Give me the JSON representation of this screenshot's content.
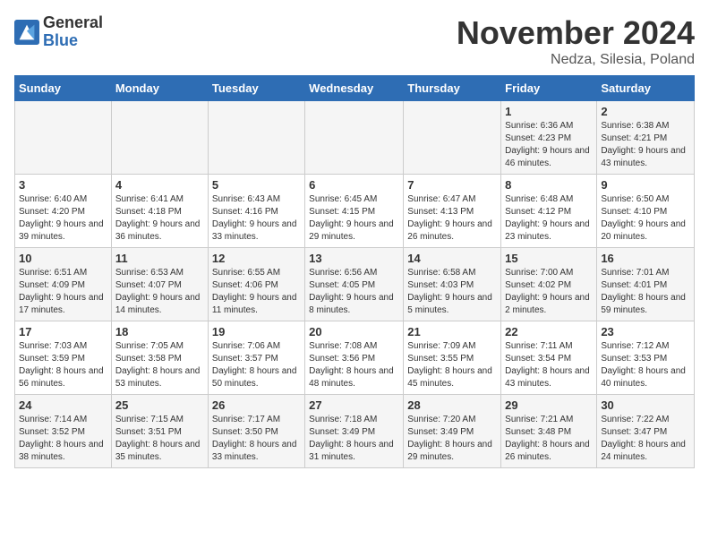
{
  "logo": {
    "general": "General",
    "blue": "Blue"
  },
  "title": "November 2024",
  "location": "Nedza, Silesia, Poland",
  "days_of_week": [
    "Sunday",
    "Monday",
    "Tuesday",
    "Wednesday",
    "Thursday",
    "Friday",
    "Saturday"
  ],
  "weeks": [
    [
      {
        "day": "",
        "info": ""
      },
      {
        "day": "",
        "info": ""
      },
      {
        "day": "",
        "info": ""
      },
      {
        "day": "",
        "info": ""
      },
      {
        "day": "",
        "info": ""
      },
      {
        "day": "1",
        "info": "Sunrise: 6:36 AM\nSunset: 4:23 PM\nDaylight: 9 hours and 46 minutes."
      },
      {
        "day": "2",
        "info": "Sunrise: 6:38 AM\nSunset: 4:21 PM\nDaylight: 9 hours and 43 minutes."
      }
    ],
    [
      {
        "day": "3",
        "info": "Sunrise: 6:40 AM\nSunset: 4:20 PM\nDaylight: 9 hours and 39 minutes."
      },
      {
        "day": "4",
        "info": "Sunrise: 6:41 AM\nSunset: 4:18 PM\nDaylight: 9 hours and 36 minutes."
      },
      {
        "day": "5",
        "info": "Sunrise: 6:43 AM\nSunset: 4:16 PM\nDaylight: 9 hours and 33 minutes."
      },
      {
        "day": "6",
        "info": "Sunrise: 6:45 AM\nSunset: 4:15 PM\nDaylight: 9 hours and 29 minutes."
      },
      {
        "day": "7",
        "info": "Sunrise: 6:47 AM\nSunset: 4:13 PM\nDaylight: 9 hours and 26 minutes."
      },
      {
        "day": "8",
        "info": "Sunrise: 6:48 AM\nSunset: 4:12 PM\nDaylight: 9 hours and 23 minutes."
      },
      {
        "day": "9",
        "info": "Sunrise: 6:50 AM\nSunset: 4:10 PM\nDaylight: 9 hours and 20 minutes."
      }
    ],
    [
      {
        "day": "10",
        "info": "Sunrise: 6:51 AM\nSunset: 4:09 PM\nDaylight: 9 hours and 17 minutes."
      },
      {
        "day": "11",
        "info": "Sunrise: 6:53 AM\nSunset: 4:07 PM\nDaylight: 9 hours and 14 minutes."
      },
      {
        "day": "12",
        "info": "Sunrise: 6:55 AM\nSunset: 4:06 PM\nDaylight: 9 hours and 11 minutes."
      },
      {
        "day": "13",
        "info": "Sunrise: 6:56 AM\nSunset: 4:05 PM\nDaylight: 9 hours and 8 minutes."
      },
      {
        "day": "14",
        "info": "Sunrise: 6:58 AM\nSunset: 4:03 PM\nDaylight: 9 hours and 5 minutes."
      },
      {
        "day": "15",
        "info": "Sunrise: 7:00 AM\nSunset: 4:02 PM\nDaylight: 9 hours and 2 minutes."
      },
      {
        "day": "16",
        "info": "Sunrise: 7:01 AM\nSunset: 4:01 PM\nDaylight: 8 hours and 59 minutes."
      }
    ],
    [
      {
        "day": "17",
        "info": "Sunrise: 7:03 AM\nSunset: 3:59 PM\nDaylight: 8 hours and 56 minutes."
      },
      {
        "day": "18",
        "info": "Sunrise: 7:05 AM\nSunset: 3:58 PM\nDaylight: 8 hours and 53 minutes."
      },
      {
        "day": "19",
        "info": "Sunrise: 7:06 AM\nSunset: 3:57 PM\nDaylight: 8 hours and 50 minutes."
      },
      {
        "day": "20",
        "info": "Sunrise: 7:08 AM\nSunset: 3:56 PM\nDaylight: 8 hours and 48 minutes."
      },
      {
        "day": "21",
        "info": "Sunrise: 7:09 AM\nSunset: 3:55 PM\nDaylight: 8 hours and 45 minutes."
      },
      {
        "day": "22",
        "info": "Sunrise: 7:11 AM\nSunset: 3:54 PM\nDaylight: 8 hours and 43 minutes."
      },
      {
        "day": "23",
        "info": "Sunrise: 7:12 AM\nSunset: 3:53 PM\nDaylight: 8 hours and 40 minutes."
      }
    ],
    [
      {
        "day": "24",
        "info": "Sunrise: 7:14 AM\nSunset: 3:52 PM\nDaylight: 8 hours and 38 minutes."
      },
      {
        "day": "25",
        "info": "Sunrise: 7:15 AM\nSunset: 3:51 PM\nDaylight: 8 hours and 35 minutes."
      },
      {
        "day": "26",
        "info": "Sunrise: 7:17 AM\nSunset: 3:50 PM\nDaylight: 8 hours and 33 minutes."
      },
      {
        "day": "27",
        "info": "Sunrise: 7:18 AM\nSunset: 3:49 PM\nDaylight: 8 hours and 31 minutes."
      },
      {
        "day": "28",
        "info": "Sunrise: 7:20 AM\nSunset: 3:49 PM\nDaylight: 8 hours and 29 minutes."
      },
      {
        "day": "29",
        "info": "Sunrise: 7:21 AM\nSunset: 3:48 PM\nDaylight: 8 hours and 26 minutes."
      },
      {
        "day": "30",
        "info": "Sunrise: 7:22 AM\nSunset: 3:47 PM\nDaylight: 8 hours and 24 minutes."
      }
    ]
  ]
}
